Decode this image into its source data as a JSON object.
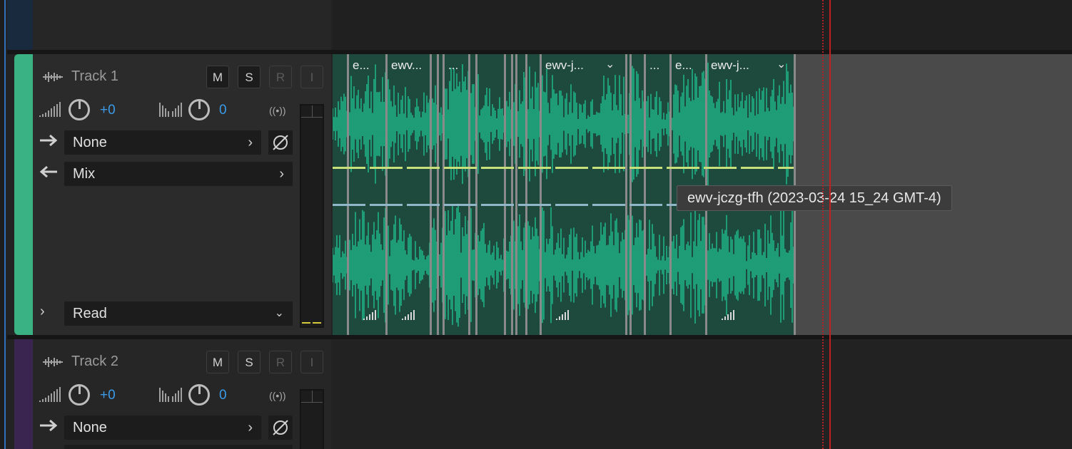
{
  "colors": {
    "track1_color": "#3ab283",
    "track2_color": "#3a2450",
    "waveform": "#1ec08f",
    "envelope_volume": "#c8e07a",
    "envelope_pan": "#8fb6c9",
    "playhead": "#c21f1f"
  },
  "tracks": [
    {
      "name": "Track 1",
      "buttons": [
        "M",
        "S",
        "R",
        "I"
      ],
      "volume": "+0",
      "pan": "0",
      "input": "None",
      "output": "Mix",
      "automation": "Read"
    },
    {
      "name": "Track 2",
      "buttons": [
        "M",
        "S",
        "R",
        "I"
      ],
      "volume": "+0",
      "pan": "0",
      "input": "None"
    }
  ],
  "clips": [
    {
      "label": "e..."
    },
    {
      "label": "ewv..."
    },
    {
      "label": "..."
    },
    {
      "label": "ewv-j..."
    },
    {
      "label": "..."
    },
    {
      "label": "e..."
    },
    {
      "label": "ewv-j..."
    }
  ],
  "tooltip": "ewv-jczg-tfh (2023-03-24 15_24 GMT-4)",
  "icons": {
    "track_type": "waveform-icon",
    "volume": "volume-bars-icon",
    "pan": "pan-bars-icon",
    "input": "arrow-right-icon",
    "output": "arrow-left-icon",
    "phase": "phase-invert-icon",
    "monitor": "radio-waves-icon",
    "expand": "chevron-right-icon"
  }
}
